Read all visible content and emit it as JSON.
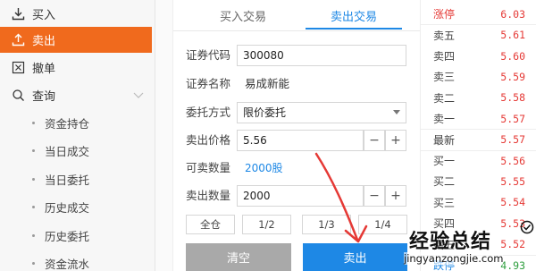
{
  "sidebar": {
    "buy": "买入",
    "sell": "卖出",
    "cancel": "撤单",
    "query": "查询",
    "sub_items": [
      "资金持仓",
      "当日成交",
      "当日委托",
      "历史成交",
      "历史委托",
      "资金流水"
    ]
  },
  "form": {
    "tabs": {
      "buy": "买入交易",
      "sell": "卖出交易"
    },
    "code_label": "证券代码",
    "code_value": "300080",
    "name_label": "证券名称",
    "name_value": "易成新能",
    "mode_label": "委托方式",
    "mode_value": "限价委托",
    "price_label": "卖出价格",
    "price_value": "5.56",
    "avail_label": "可卖数量",
    "avail_value": "2000股",
    "qty_label": "卖出数量",
    "qty_value": "2000",
    "minus": "−",
    "plus": "+",
    "fractions": [
      "全仓",
      "1/2",
      "1/3",
      "1/4"
    ],
    "clear_btn": "清空",
    "sell_btn": "卖出"
  },
  "quotes": {
    "rows": [
      {
        "name": "涨停",
        "price": "6.03",
        "name_color": "red",
        "price_color": "red"
      },
      {
        "name": "卖五",
        "price": "5.61",
        "name_color": "normal",
        "price_color": "red"
      },
      {
        "name": "卖四",
        "price": "5.60",
        "name_color": "normal",
        "price_color": "red"
      },
      {
        "name": "卖三",
        "price": "5.59",
        "name_color": "normal",
        "price_color": "red"
      },
      {
        "name": "卖二",
        "price": "5.58",
        "name_color": "normal",
        "price_color": "red"
      },
      {
        "name": "卖一",
        "price": "5.57",
        "name_color": "normal",
        "price_color": "red"
      },
      {
        "name": "最新",
        "price": "5.57",
        "name_color": "normal",
        "price_color": "red"
      },
      {
        "name": "买一",
        "price": "5.56",
        "name_color": "normal",
        "price_color": "red"
      },
      {
        "name": "买二",
        "price": "5.55",
        "name_color": "normal",
        "price_color": "red"
      },
      {
        "name": "买三",
        "price": "5.54",
        "name_color": "normal",
        "price_color": "red"
      },
      {
        "name": "买四",
        "price": "5.53",
        "name_color": "normal",
        "price_color": "red"
      },
      {
        "name": "买五",
        "price": "5.52",
        "name_color": "normal",
        "price_color": "red"
      },
      {
        "name": "跌停",
        "price": "4.93",
        "name_color": "blue",
        "price_color": "green"
      }
    ]
  },
  "watermark": {
    "cn": "经验总结",
    "en": "jingyanzongjie.com"
  },
  "colors": {
    "accent_orange": "#f06a1d",
    "accent_blue": "#1e88e5",
    "price_red": "#e53935",
    "price_green": "#2e9e3e",
    "clear_gray": "#a9a9a9"
  }
}
